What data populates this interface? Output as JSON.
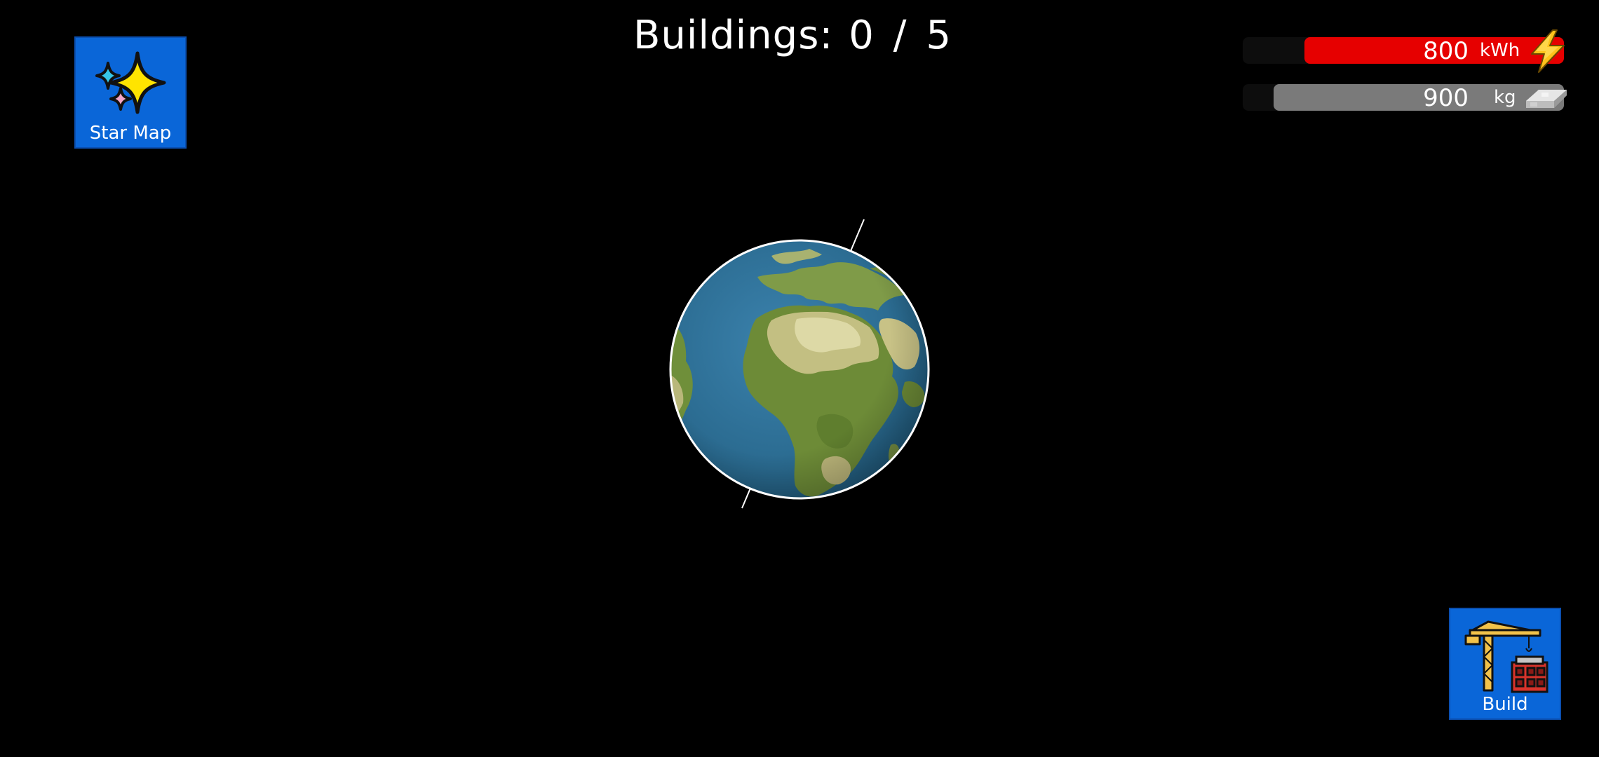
{
  "hud": {
    "buildings_label": "Buildings:",
    "buildings_value": "0 / 5"
  },
  "buttons": {
    "star_map_label": "Star Map",
    "build_label": "Build"
  },
  "resources": {
    "energy": {
      "amount": "800",
      "unit": "kWh",
      "icon": "lightning-bolt-icon",
      "color": "#e60000"
    },
    "metal": {
      "amount": "900",
      "unit": "kg",
      "icon": "metal-ingot-icon",
      "color": "#7a7a7a"
    }
  },
  "planet": {
    "icon": "earth-planet"
  },
  "colors": {
    "background": "#000000",
    "button": "#0a66d8",
    "ocean": "#2f6f94"
  }
}
